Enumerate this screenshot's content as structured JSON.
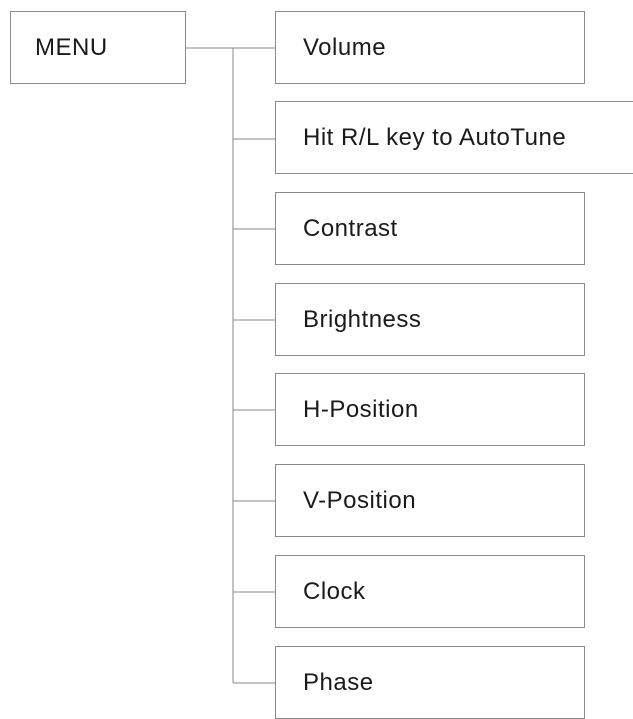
{
  "root": {
    "label": "MENU"
  },
  "items": [
    {
      "label": "Volume"
    },
    {
      "label": "Hit R/L key to AutoTune"
    },
    {
      "label": "Contrast"
    },
    {
      "label": "Brightness"
    },
    {
      "label": "H-Position"
    },
    {
      "label": "V-Position"
    },
    {
      "label": "Clock"
    },
    {
      "label": "Phase"
    }
  ]
}
